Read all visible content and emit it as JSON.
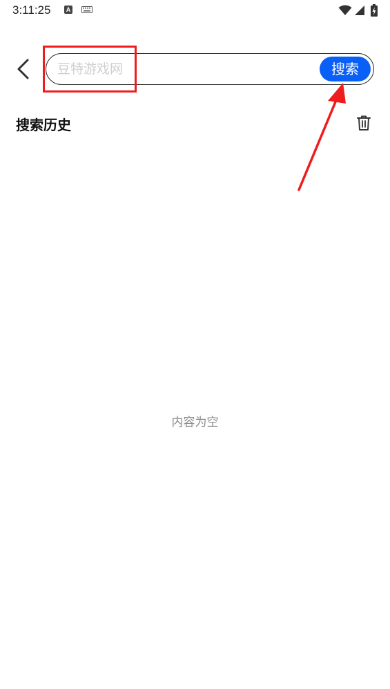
{
  "status_bar": {
    "time": "3:11:25",
    "a_badge": "A",
    "icons": [
      "a-notification-icon",
      "keyboard-icon",
      "wifi-icon",
      "signal-icon",
      "battery-charging-icon"
    ]
  },
  "header": {
    "back_icon": "chevron-left-icon",
    "search_placeholder": "豆特游戏网",
    "search_value": "",
    "search_button_label": "搜索"
  },
  "history": {
    "title": "搜索历史",
    "clear_icon": "trash-icon",
    "empty_text": "内容为空"
  },
  "colors": {
    "accent": "#0a5ff6",
    "annotation": "#ee1c1c",
    "placeholder": "#cfcfcf",
    "empty_text": "#8a8a8a"
  }
}
